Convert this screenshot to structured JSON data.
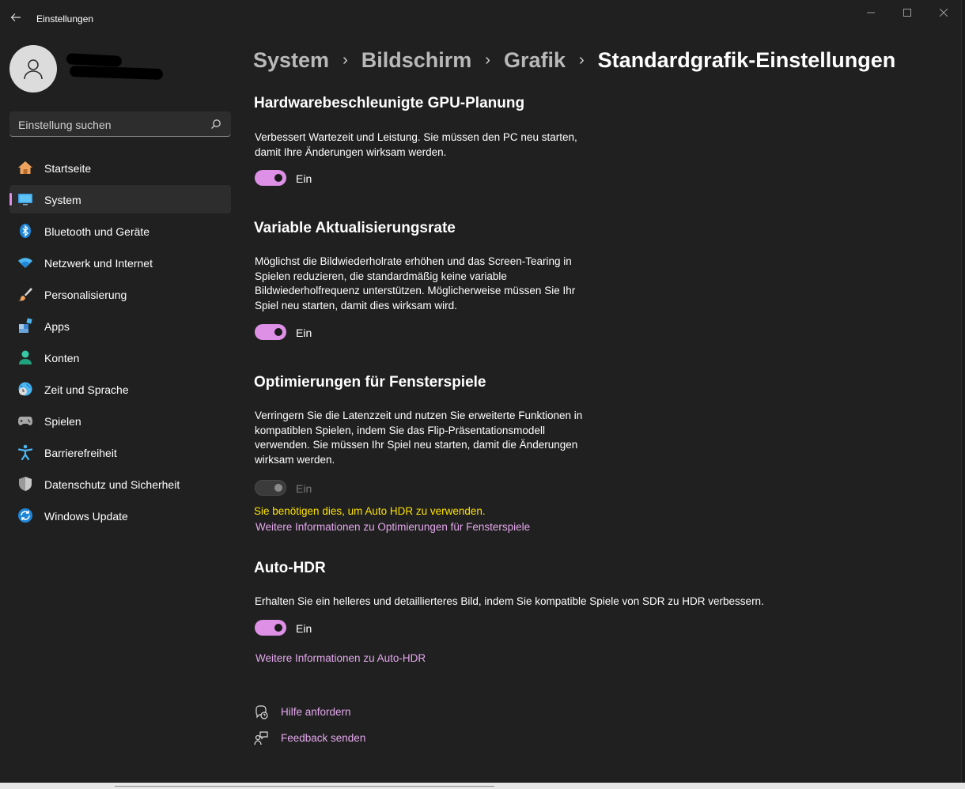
{
  "window": {
    "title": "Einstellungen"
  },
  "search": {
    "placeholder": "Einstellung suchen"
  },
  "sidebar": {
    "items": [
      {
        "label": "Startseite",
        "icon": "home-icon"
      },
      {
        "label": "System",
        "icon": "monitor-icon",
        "active": true
      },
      {
        "label": "Bluetooth und Geräte",
        "icon": "bluetooth-icon"
      },
      {
        "label": "Netzwerk und Internet",
        "icon": "wifi-icon"
      },
      {
        "label": "Personalisierung",
        "icon": "brush-icon"
      },
      {
        "label": "Apps",
        "icon": "apps-icon"
      },
      {
        "label": "Konten",
        "icon": "account-icon"
      },
      {
        "label": "Zeit und Sprache",
        "icon": "globe-clock-icon"
      },
      {
        "label": "Spielen",
        "icon": "gamepad-icon"
      },
      {
        "label": "Barrierefreiheit",
        "icon": "accessibility-icon"
      },
      {
        "label": "Datenschutz und Sicherheit",
        "icon": "shield-icon"
      },
      {
        "label": "Windows Update",
        "icon": "update-icon"
      }
    ]
  },
  "breadcrumb": [
    "System",
    "Bildschirm",
    "Grafik",
    "Standardgrafik-Einstellungen"
  ],
  "sections": {
    "gpu": {
      "title": "Hardwarebeschleunigte GPU-Planung",
      "description": "Verbessert Wartezeit und Leistung. Sie müssen den PC neu starten, damit Ihre Änderungen wirksam werden.",
      "toggle_state": "Ein",
      "enabled": true
    },
    "vrr": {
      "title": "Variable Aktualisierungsrate",
      "description": "Möglichst die Bildwiederholrate erhöhen und das Screen-Tearing in Spielen reduzieren, die standardmäßig keine variable Bildwiederholfrequenz unterstützen. Möglicherweise müssen Sie Ihr Spiel neu starten, damit dies wirksam wird.",
      "toggle_state": "Ein",
      "enabled": true
    },
    "windowed": {
      "title": "Optimierungen für Fensterspiele",
      "description": "Verringern Sie die Latenzzeit und nutzen Sie erweiterte Funktionen in kompatiblen Spielen, indem Sie das Flip-Präsentationsmodell verwenden. Sie müssen Ihr Spiel neu starten, damit die Änderungen wirksam werden.",
      "toggle_state": "Ein",
      "enabled": false,
      "warning": "Sie benötigen dies, um Auto HDR zu verwenden.",
      "link": "Weitere Informationen zu Optimierungen für Fensterspiele"
    },
    "autohdr": {
      "title": "Auto-HDR",
      "description": "Erhalten Sie ein helleres und detaillierteres Bild, indem Sie kompatible Spiele von SDR zu HDR verbessern.",
      "toggle_state": "Ein",
      "enabled": true,
      "link": "Weitere Informationen zu Auto-HDR"
    }
  },
  "help": {
    "get_help": "Hilfe anfordern",
    "feedback": "Feedback senden"
  },
  "colors": {
    "accent": "#dd90e6",
    "link": "#e3a8ec",
    "warning": "#fce100",
    "background": "#202020"
  }
}
